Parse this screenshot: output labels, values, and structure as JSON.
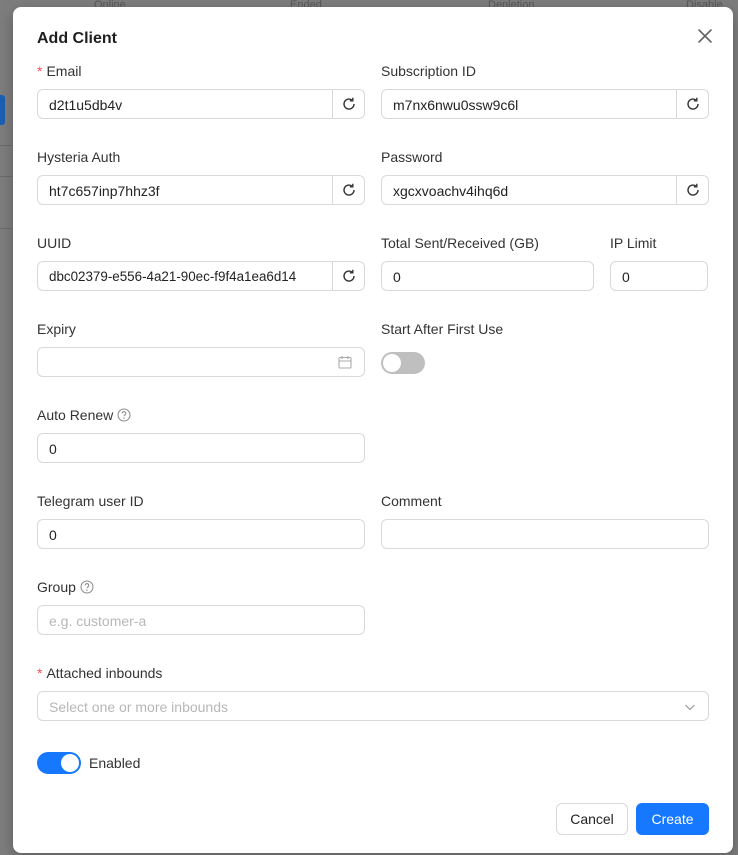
{
  "background": {
    "headers": [
      "Online",
      "Ended",
      "Depletion",
      "Disable"
    ]
  },
  "modal": {
    "title": "Add Client",
    "fields": {
      "email": {
        "label": "Email",
        "value": "d2t1u5db4v"
      },
      "subscription_id": {
        "label": "Subscription ID",
        "value": "m7nx6nwu0ssw9c6l"
      },
      "hysteria_auth": {
        "label": "Hysteria Auth",
        "value": "ht7c657inp7hhz3f"
      },
      "password": {
        "label": "Password",
        "value": "xgcxvoachv4ihq6d"
      },
      "uuid": {
        "label": "UUID",
        "value": "dbc02379-e556-4a21-90ec-f9f4a1ea6d14"
      },
      "total_traffic": {
        "label": "Total Sent/Received (GB)",
        "value": "0"
      },
      "ip_limit": {
        "label": "IP Limit",
        "value": "0"
      },
      "expiry": {
        "label": "Expiry",
        "value": ""
      },
      "start_after_first_use": {
        "label": "Start After First Use",
        "on": false
      },
      "auto_renew": {
        "label": "Auto Renew",
        "value": "0"
      },
      "telegram_user_id": {
        "label": "Telegram user ID",
        "value": "0"
      },
      "comment": {
        "label": "Comment",
        "value": ""
      },
      "group": {
        "label": "Group",
        "placeholder": "e.g. customer-a"
      },
      "attached_inbounds": {
        "label": "Attached inbounds",
        "placeholder": "Select one or more inbounds"
      },
      "enabled": {
        "label": "Enabled",
        "on": true
      }
    },
    "buttons": {
      "cancel": "Cancel",
      "create": "Create"
    }
  },
  "colors": {
    "primary": "#1677ff",
    "required": "#ff4d4f",
    "border": "#d9d9d9",
    "switch_off": "#bfbfbf"
  },
  "icons": {
    "refresh": "reload-icon",
    "close": "close-icon",
    "calendar": "calendar-icon",
    "help": "question-circle-icon",
    "dropdown": "chevron-down-icon"
  }
}
